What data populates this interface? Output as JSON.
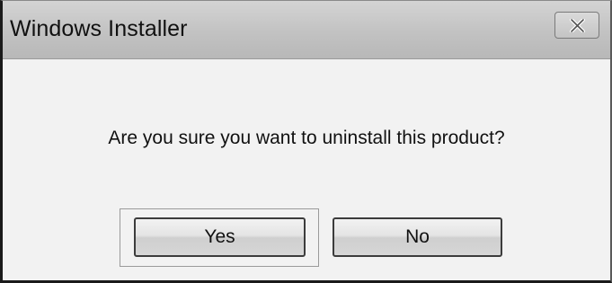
{
  "window": {
    "title": "Windows Installer",
    "close_icon": "close-icon"
  },
  "message": {
    "text": "Are you sure you want to uninstall this product?"
  },
  "buttons": {
    "yes_label": "Yes",
    "no_label": "No",
    "default": "Yes"
  }
}
